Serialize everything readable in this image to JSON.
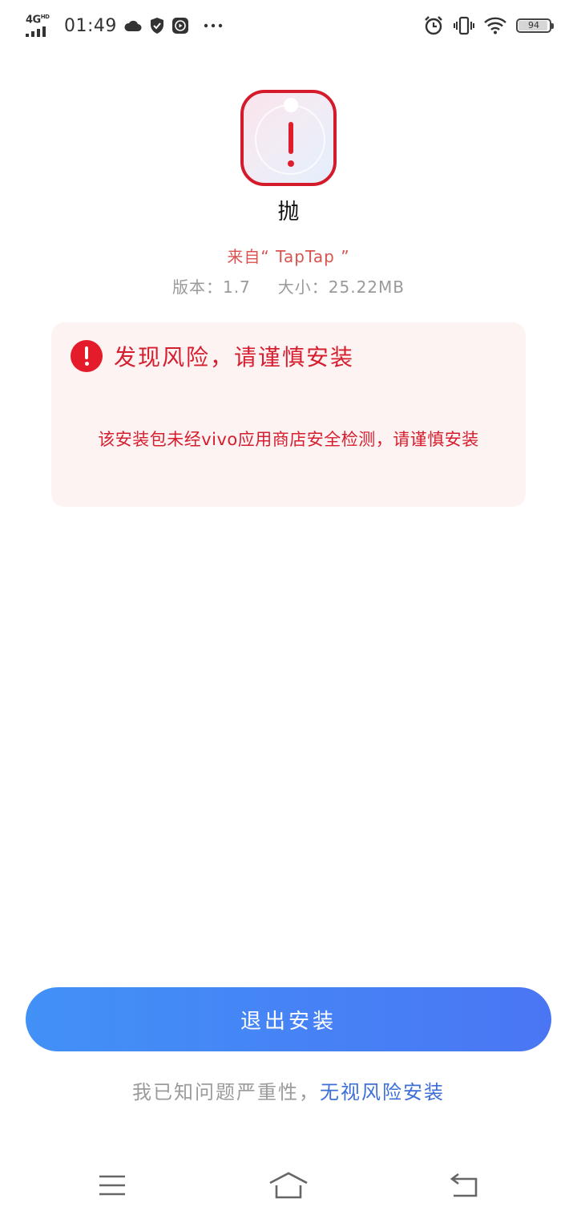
{
  "status_bar": {
    "network_type": "4G",
    "network_sub": "HD",
    "time": "01:49",
    "battery_level": "94",
    "battery_fraction": 0.94,
    "icons": [
      "cloud-icon",
      "shield-icon",
      "play-icon",
      "more-dots-icon",
      "alarm-icon",
      "vibrate-icon",
      "wifi-icon",
      "battery-icon"
    ]
  },
  "app": {
    "icon": "alert-app-icon",
    "name": "抛",
    "source": "来自“ TapTap ”",
    "version_label": "版本：1.7",
    "size_label": "大小：25.22MB"
  },
  "risk": {
    "icon": "alert-circle-icon",
    "title": "发现风险，请谨慎安装",
    "description": "该安装包未经vivo应用商店安全检测，请谨慎安装"
  },
  "actions": {
    "exit_label": "退出安装",
    "ignore_hint": "我已知问题严重性，",
    "ignore_link": "无视风险安装"
  },
  "nav_bar": {
    "icons": [
      "menu-icon",
      "home-icon",
      "back-icon"
    ]
  },
  "colors": {
    "danger": "#d61e2e",
    "card_bg": "#fdf3f3",
    "primary_start": "#4291f7",
    "primary_end": "#4a76f4",
    "link": "#3e6fd9",
    "muted": "#9b9b9b"
  }
}
